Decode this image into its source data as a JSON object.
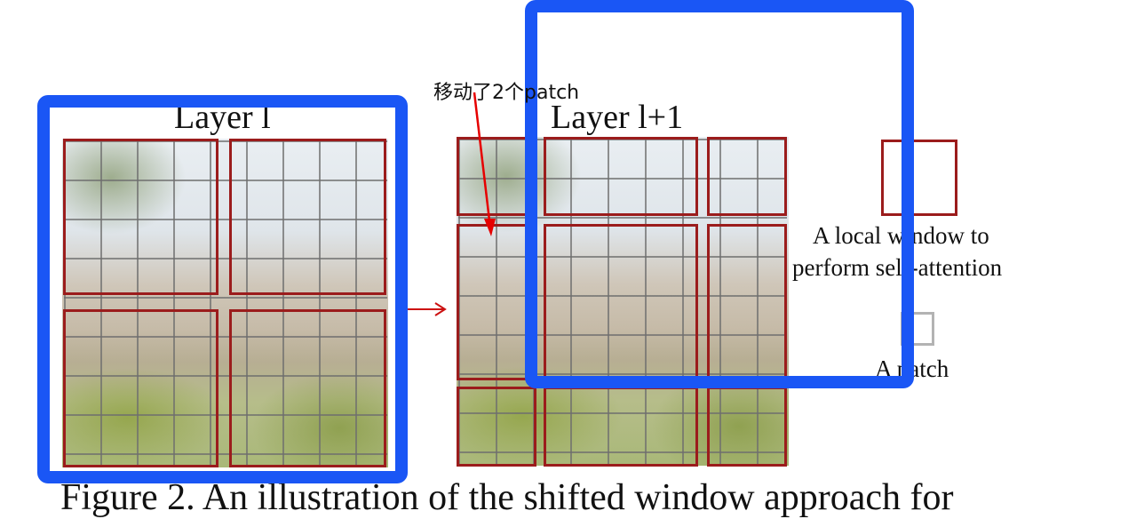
{
  "layer_left_title": "Layer l",
  "layer_right_title": "Layer l+1",
  "annotation": "移动了2个patch",
  "legend": {
    "window_line1": "A local window to",
    "window_line2": "perform self-attention",
    "patch_label": "A patch"
  },
  "caption": "Figure 2. An illustration of the shifted window approach for",
  "colors": {
    "window_border": "#9b1c1c",
    "highlight_box": "#1a56f5",
    "annotation_arrow": "#e60000",
    "flow_arrow": "#cc1111"
  },
  "icons": {
    "flow_arrow": "right-arrow-icon",
    "annotation_arrow": "pointer-arrow-icon"
  }
}
